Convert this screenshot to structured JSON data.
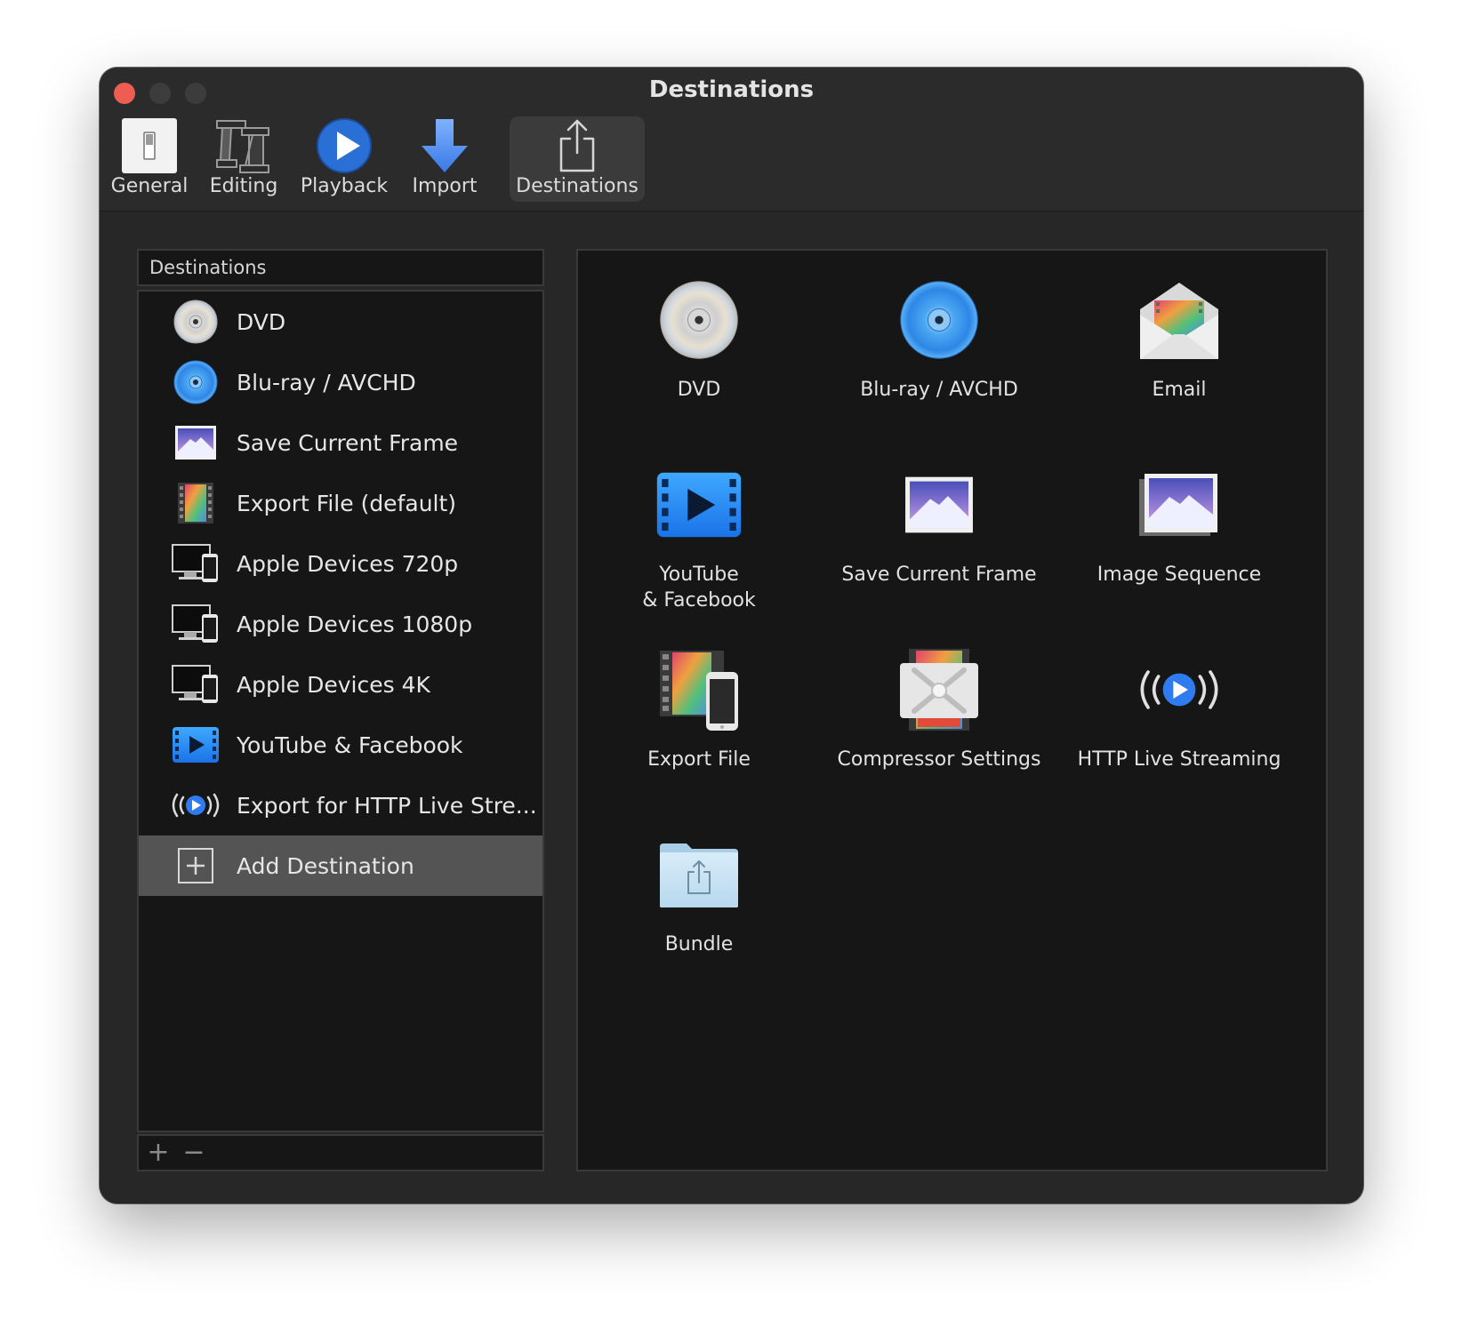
{
  "window": {
    "title": "Destinations"
  },
  "toolbar": {
    "items": [
      {
        "label": "General",
        "icon": "general-icon"
      },
      {
        "label": "Editing",
        "icon": "editing-icon"
      },
      {
        "label": "Playback",
        "icon": "playback-icon"
      },
      {
        "label": "Import",
        "icon": "import-icon"
      },
      {
        "label": "Destinations",
        "icon": "share-icon",
        "active": true
      }
    ]
  },
  "sidebar": {
    "header": "Destinations",
    "items": [
      {
        "label": "DVD",
        "icon": "dvd-icon"
      },
      {
        "label": "Blu-ray / AVCHD",
        "icon": "bluray-icon"
      },
      {
        "label": "Save Current Frame",
        "icon": "frame-image-icon"
      },
      {
        "label": "Export File (default)",
        "icon": "film-strip-icon"
      },
      {
        "label": "Apple Devices 720p",
        "icon": "apple-devices-icon"
      },
      {
        "label": "Apple Devices 1080p",
        "icon": "apple-devices-icon"
      },
      {
        "label": "Apple Devices 4K",
        "icon": "apple-devices-icon"
      },
      {
        "label": "YouTube & Facebook",
        "icon": "video-play-icon"
      },
      {
        "label": "Export for HTTP Live Stre...",
        "icon": "live-streaming-icon"
      },
      {
        "label": "Add Destination",
        "icon": "add-box-icon",
        "selected": true
      }
    ],
    "footer": {
      "add": "+",
      "remove": "−"
    }
  },
  "grid": {
    "items": [
      {
        "label": "DVD",
        "icon": "dvd-icon"
      },
      {
        "label": "Blu-ray / AVCHD",
        "icon": "bluray-icon"
      },
      {
        "label": "Email",
        "icon": "email-icon"
      },
      {
        "label": "YouTube\n& Facebook",
        "icon": "video-play-icon"
      },
      {
        "label": "Save Current Frame",
        "icon": "frame-image-icon"
      },
      {
        "label": "Image Sequence",
        "icon": "image-sequence-icon"
      },
      {
        "label": "Export File",
        "icon": "export-file-icon"
      },
      {
        "label": "Compressor Settings",
        "icon": "compressor-icon"
      },
      {
        "label": "HTTP Live Streaming",
        "icon": "live-streaming-icon"
      },
      {
        "label": "Bundle",
        "icon": "bundle-folder-icon"
      }
    ]
  },
  "colors": {
    "window_bg": "#272727",
    "panel_bg": "#161616",
    "selection": "#545454",
    "close_button": "#ee5d52",
    "accent_blue": "#2f7bf0"
  }
}
